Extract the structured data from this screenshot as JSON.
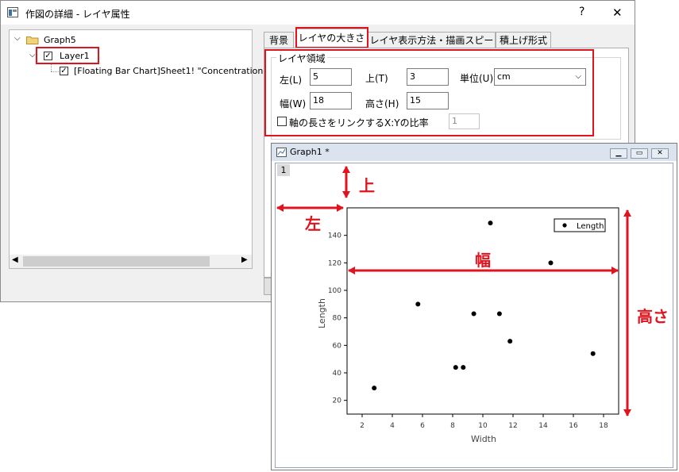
{
  "dialog": {
    "title": "作図の詳細 - レイヤ属性",
    "help_label": "?",
    "close_label": "✕",
    "tree": {
      "graph": "Graph5",
      "layer": "Layer1",
      "plot": "[Floating Bar Chart]Sheet1! \"Concentration\""
    },
    "tabs": [
      "背景",
      "レイヤの大きさ",
      "レイヤ表示方法・描画スピード",
      "積上げ形式"
    ],
    "group_title": "レイヤ領域",
    "fields": {
      "left_label": "左(L)",
      "left_value": "5",
      "top_label": "上(T)",
      "top_value": "3",
      "unit_label": "単位(U)",
      "unit_value": "cm",
      "width_label": "幅(W)",
      "width_value": "18",
      "height_label": "高さ(H)",
      "height_value": "15",
      "link_label": "軸の長さをリンクするX:Yの比率",
      "link_value": "1"
    }
  },
  "graph_window": {
    "title": "Graph1 *",
    "layer_index": "1",
    "annotations": {
      "top": "上",
      "left": "左",
      "width": "幅",
      "height": "高さ"
    }
  },
  "chart_data": {
    "type": "scatter",
    "xlabel": "Width",
    "ylabel": "Length",
    "xlim": [
      1,
      19
    ],
    "ylim": [
      10,
      160
    ],
    "x_ticks": [
      2,
      4,
      6,
      8,
      10,
      12,
      14,
      16,
      18
    ],
    "y_ticks": [
      20,
      40,
      60,
      80,
      100,
      120,
      140
    ],
    "legend": "Length",
    "legend_position": "top-right",
    "color": "#000000",
    "x": [
      2.8,
      5.7,
      8.2,
      8.7,
      9.4,
      10.5,
      11.1,
      11.8,
      14.5,
      17.3
    ],
    "y": [
      29,
      90,
      44,
      44,
      83,
      149,
      83,
      63,
      120,
      54
    ]
  }
}
